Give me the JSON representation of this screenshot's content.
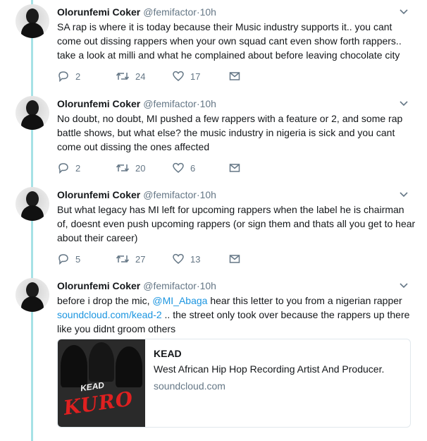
{
  "author": {
    "name": "Olorunfemi Coker",
    "handle": "@femifactor",
    "time_sep": "·",
    "time": "10h"
  },
  "tweets": [
    {
      "text": "SA rap is where it is today because their Music industry supports it.. you cant come out dissing rappers when your own squad cant even show forth rappers.. take a look at milli and what he complained about before leaving chocolate city",
      "replies": "2",
      "retweets": "24",
      "likes": "17"
    },
    {
      "text": "No doubt, no doubt, MI pushed a few rappers with a feature or 2, and some rap battle shows, but what else? the music industry in nigeria is sick and you cant come out dissing the ones affected",
      "replies": "2",
      "retweets": "20",
      "likes": "6"
    },
    {
      "text": "But what legacy has MI left for upcoming rappers when the label he is chairman of, doesnt even push upcoming rappers (or sign them and thats all you get to hear about their career)",
      "replies": "5",
      "retweets": "27",
      "likes": "13"
    },
    {
      "text_parts": {
        "p1": "before i drop the mic, ",
        "mention": "@MI_Abaga",
        "p2": " hear this letter to you from a nigerian rapper ",
        "link": "soundcloud.com/kead-2",
        "p3": " .. the street only took over because the rappers up there like you didnt groom others"
      },
      "card": {
        "title": "KEAD",
        "description": "West African Hip Hop Recording Artist And Producer.",
        "domain": "soundcloud.com",
        "image_text_1": "KEAD",
        "image_text_2": "KURO"
      }
    }
  ],
  "icons": {
    "reply": "reply-icon",
    "retweet": "retweet-icon",
    "like": "heart-icon",
    "dm": "envelope-icon",
    "more": "chevron-down-icon"
  },
  "colors": {
    "thread_line": "#a6e2e6",
    "link": "#1b95e0",
    "muted": "#657786",
    "text": "#14171a"
  }
}
